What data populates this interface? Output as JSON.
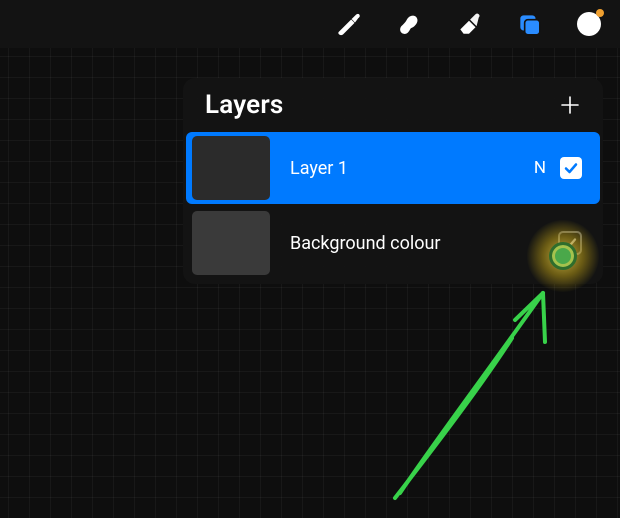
{
  "toolbar": {
    "icons": [
      "brush",
      "smudge",
      "eraser",
      "layers",
      "color"
    ],
    "active": "layers",
    "colors": {
      "active": "#2a8cff",
      "inactive": "#ffffff",
      "swatch": "#ffffff",
      "swatch_dot": "#f0a030"
    }
  },
  "panel": {
    "title": "Layers",
    "add_label": "+",
    "rows": [
      {
        "name": "Layer 1",
        "blend": "N",
        "visible": true,
        "selected": true
      },
      {
        "name": "Background colour",
        "visible": true,
        "is_background": true
      }
    ]
  },
  "colors": {
    "selection_blue": "#007aff",
    "panel_bg": "#141414",
    "checkmark": "#007aff"
  },
  "annotation": {
    "arrow_color": "#38d24a"
  },
  "canvas": {
    "grid_spacing_px": 21
  }
}
